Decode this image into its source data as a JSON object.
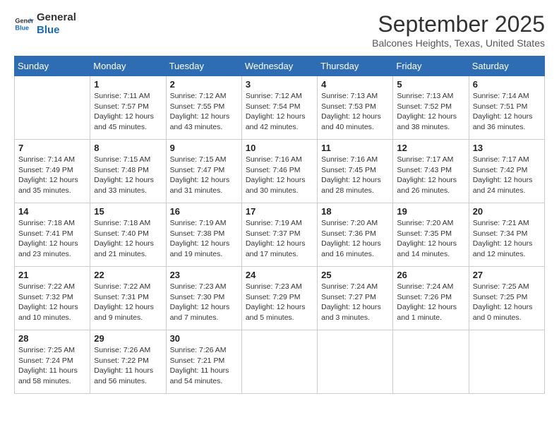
{
  "logo": {
    "line1": "General",
    "line2": "Blue"
  },
  "title": "September 2025",
  "location": "Balcones Heights, Texas, United States",
  "weekdays": [
    "Sunday",
    "Monday",
    "Tuesday",
    "Wednesday",
    "Thursday",
    "Friday",
    "Saturday"
  ],
  "weeks": [
    [
      {
        "day": "",
        "info": ""
      },
      {
        "day": "1",
        "info": "Sunrise: 7:11 AM\nSunset: 7:57 PM\nDaylight: 12 hours\nand 45 minutes."
      },
      {
        "day": "2",
        "info": "Sunrise: 7:12 AM\nSunset: 7:55 PM\nDaylight: 12 hours\nand 43 minutes."
      },
      {
        "day": "3",
        "info": "Sunrise: 7:12 AM\nSunset: 7:54 PM\nDaylight: 12 hours\nand 42 minutes."
      },
      {
        "day": "4",
        "info": "Sunrise: 7:13 AM\nSunset: 7:53 PM\nDaylight: 12 hours\nand 40 minutes."
      },
      {
        "day": "5",
        "info": "Sunrise: 7:13 AM\nSunset: 7:52 PM\nDaylight: 12 hours\nand 38 minutes."
      },
      {
        "day": "6",
        "info": "Sunrise: 7:14 AM\nSunset: 7:51 PM\nDaylight: 12 hours\nand 36 minutes."
      }
    ],
    [
      {
        "day": "7",
        "info": "Sunrise: 7:14 AM\nSunset: 7:49 PM\nDaylight: 12 hours\nand 35 minutes."
      },
      {
        "day": "8",
        "info": "Sunrise: 7:15 AM\nSunset: 7:48 PM\nDaylight: 12 hours\nand 33 minutes."
      },
      {
        "day": "9",
        "info": "Sunrise: 7:15 AM\nSunset: 7:47 PM\nDaylight: 12 hours\nand 31 minutes."
      },
      {
        "day": "10",
        "info": "Sunrise: 7:16 AM\nSunset: 7:46 PM\nDaylight: 12 hours\nand 30 minutes."
      },
      {
        "day": "11",
        "info": "Sunrise: 7:16 AM\nSunset: 7:45 PM\nDaylight: 12 hours\nand 28 minutes."
      },
      {
        "day": "12",
        "info": "Sunrise: 7:17 AM\nSunset: 7:43 PM\nDaylight: 12 hours\nand 26 minutes."
      },
      {
        "day": "13",
        "info": "Sunrise: 7:17 AM\nSunset: 7:42 PM\nDaylight: 12 hours\nand 24 minutes."
      }
    ],
    [
      {
        "day": "14",
        "info": "Sunrise: 7:18 AM\nSunset: 7:41 PM\nDaylight: 12 hours\nand 23 minutes."
      },
      {
        "day": "15",
        "info": "Sunrise: 7:18 AM\nSunset: 7:40 PM\nDaylight: 12 hours\nand 21 minutes."
      },
      {
        "day": "16",
        "info": "Sunrise: 7:19 AM\nSunset: 7:38 PM\nDaylight: 12 hours\nand 19 minutes."
      },
      {
        "day": "17",
        "info": "Sunrise: 7:19 AM\nSunset: 7:37 PM\nDaylight: 12 hours\nand 17 minutes."
      },
      {
        "day": "18",
        "info": "Sunrise: 7:20 AM\nSunset: 7:36 PM\nDaylight: 12 hours\nand 16 minutes."
      },
      {
        "day": "19",
        "info": "Sunrise: 7:20 AM\nSunset: 7:35 PM\nDaylight: 12 hours\nand 14 minutes."
      },
      {
        "day": "20",
        "info": "Sunrise: 7:21 AM\nSunset: 7:34 PM\nDaylight: 12 hours\nand 12 minutes."
      }
    ],
    [
      {
        "day": "21",
        "info": "Sunrise: 7:22 AM\nSunset: 7:32 PM\nDaylight: 12 hours\nand 10 minutes."
      },
      {
        "day": "22",
        "info": "Sunrise: 7:22 AM\nSunset: 7:31 PM\nDaylight: 12 hours\nand 9 minutes."
      },
      {
        "day": "23",
        "info": "Sunrise: 7:23 AM\nSunset: 7:30 PM\nDaylight: 12 hours\nand 7 minutes."
      },
      {
        "day": "24",
        "info": "Sunrise: 7:23 AM\nSunset: 7:29 PM\nDaylight: 12 hours\nand 5 minutes."
      },
      {
        "day": "25",
        "info": "Sunrise: 7:24 AM\nSunset: 7:27 PM\nDaylight: 12 hours\nand 3 minutes."
      },
      {
        "day": "26",
        "info": "Sunrise: 7:24 AM\nSunset: 7:26 PM\nDaylight: 12 hours\nand 1 minute."
      },
      {
        "day": "27",
        "info": "Sunrise: 7:25 AM\nSunset: 7:25 PM\nDaylight: 12 hours\nand 0 minutes."
      }
    ],
    [
      {
        "day": "28",
        "info": "Sunrise: 7:25 AM\nSunset: 7:24 PM\nDaylight: 11 hours\nand 58 minutes."
      },
      {
        "day": "29",
        "info": "Sunrise: 7:26 AM\nSunset: 7:22 PM\nDaylight: 11 hours\nand 56 minutes."
      },
      {
        "day": "30",
        "info": "Sunrise: 7:26 AM\nSunset: 7:21 PM\nDaylight: 11 hours\nand 54 minutes."
      },
      {
        "day": "",
        "info": ""
      },
      {
        "day": "",
        "info": ""
      },
      {
        "day": "",
        "info": ""
      },
      {
        "day": "",
        "info": ""
      }
    ]
  ]
}
